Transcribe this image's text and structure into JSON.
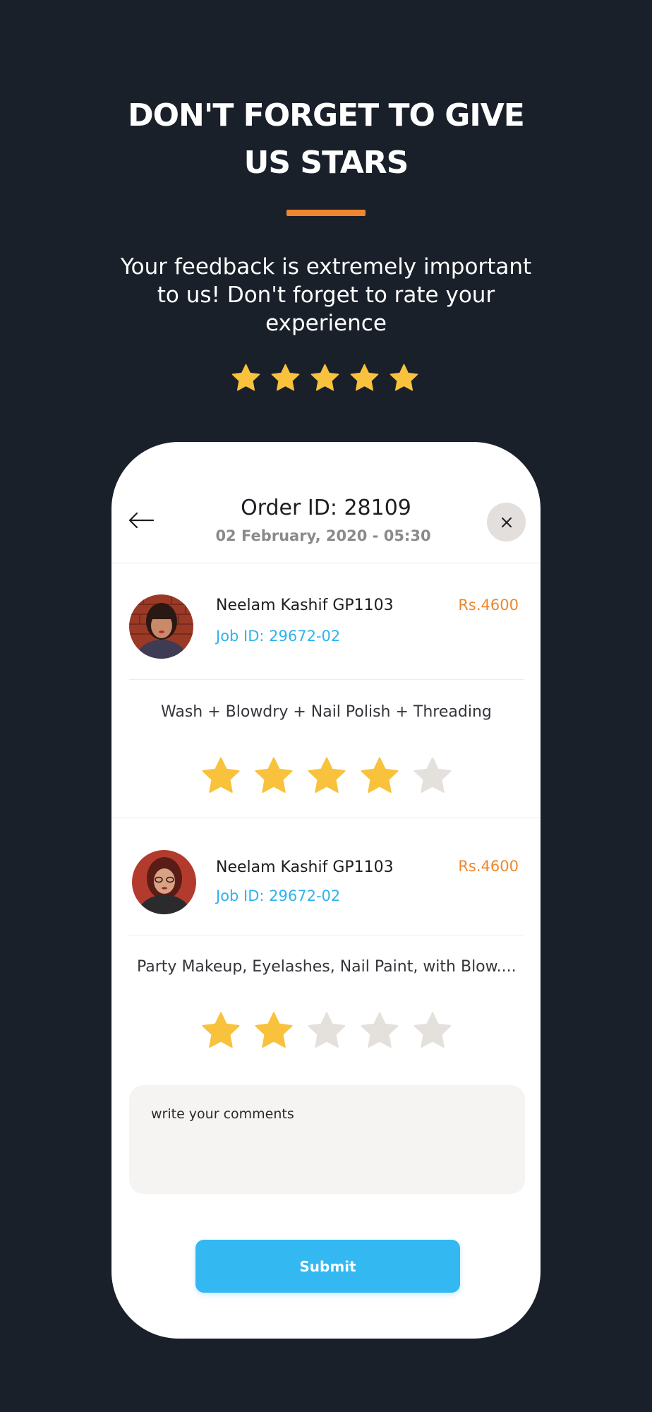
{
  "promo": {
    "title_line1": "DON'T FORGET TO GIVE",
    "title_line2": "US STARS",
    "subtitle": "Your feedback is extremely important to us! Don't forget to rate your experience",
    "star_count": 5
  },
  "colors": {
    "background": "#19202a",
    "accent": "#f0862d",
    "star_filled": "#f8c23d",
    "star_empty": "#e4e0dc",
    "link": "#2fb3ef",
    "button": "#33b8f2"
  },
  "order": {
    "title": "Order ID: 28109",
    "date": "02 February, 2020 - 05:30"
  },
  "icons": {
    "back": "arrow-left-icon",
    "close": "close-icon",
    "star": "star-icon"
  },
  "bookings": [
    {
      "provider": "Neelam Kashif GP1103",
      "job_id": "Job ID: 29672-02",
      "price": "Rs.4600",
      "services": "Wash + Blowdry + Nail Polish + Threading",
      "rating": 4,
      "max_rating": 5
    },
    {
      "provider": "Neelam Kashif GP1103",
      "job_id": "Job ID: 29672-02",
      "price": "Rs.4600",
      "services": "Party Makeup, Eyelashes, Nail Paint, with Blow....",
      "rating": 2,
      "max_rating": 5
    }
  ],
  "comment": {
    "placeholder": "write your comments",
    "value": ""
  },
  "submit_label": "Submit"
}
